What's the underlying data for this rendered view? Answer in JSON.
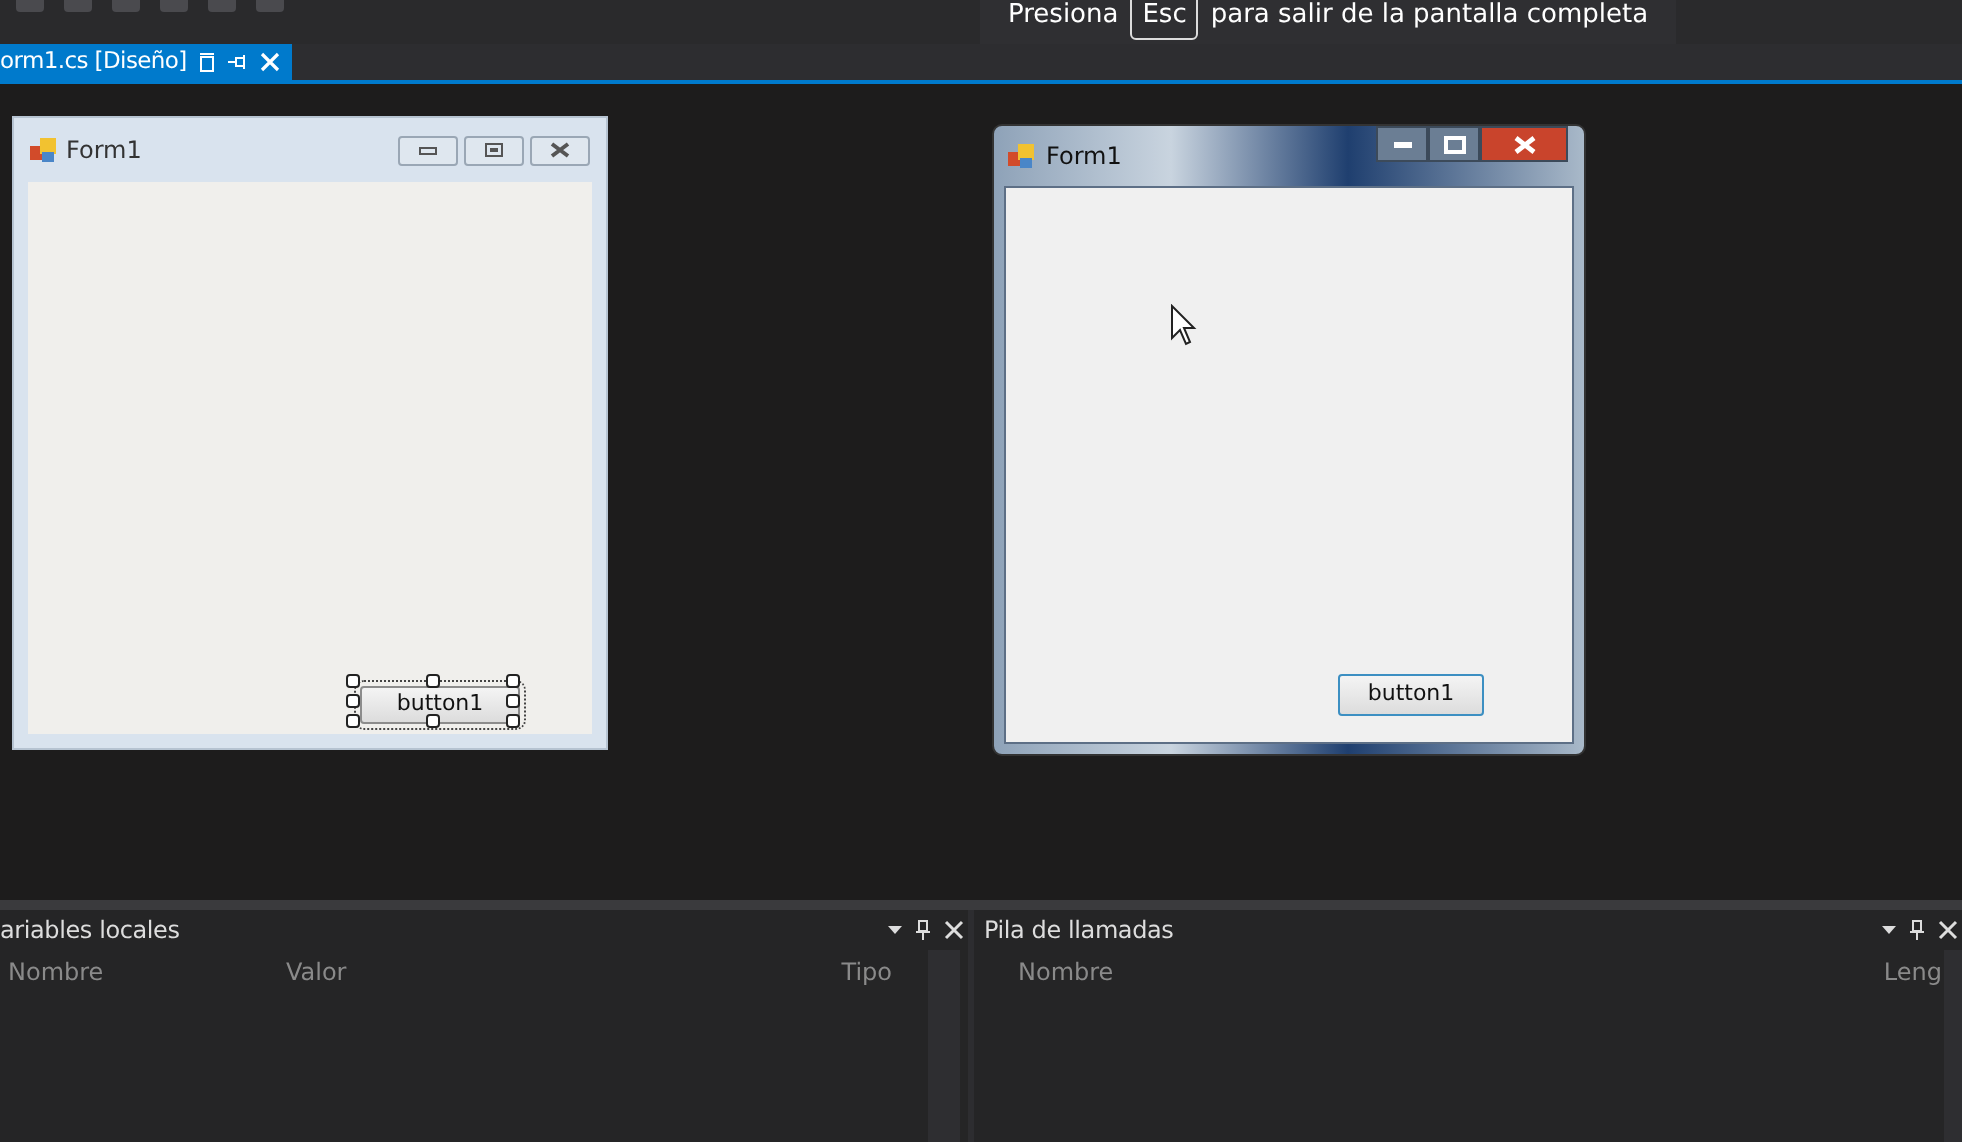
{
  "toolbar": {
    "fullscreen_notice": {
      "before": "Presiona",
      "key": "Esc",
      "after": "para salir de la pantalla completa"
    }
  },
  "document_tabs": [
    {
      "label": "orm1.cs [Diseño]",
      "selected": true
    }
  ],
  "designer_form": {
    "title": "Form1",
    "button": {
      "label": "button1",
      "selected": true
    }
  },
  "running_form": {
    "title": "Form1",
    "button": {
      "label": "button1"
    }
  },
  "panels": [
    {
      "title": "ariables locales",
      "columns": [
        "Nombre",
        "Valor",
        "Tipo"
      ]
    },
    {
      "title": "Pila de llamadas",
      "columns": [
        "Nombre",
        "Leng"
      ]
    }
  ]
}
